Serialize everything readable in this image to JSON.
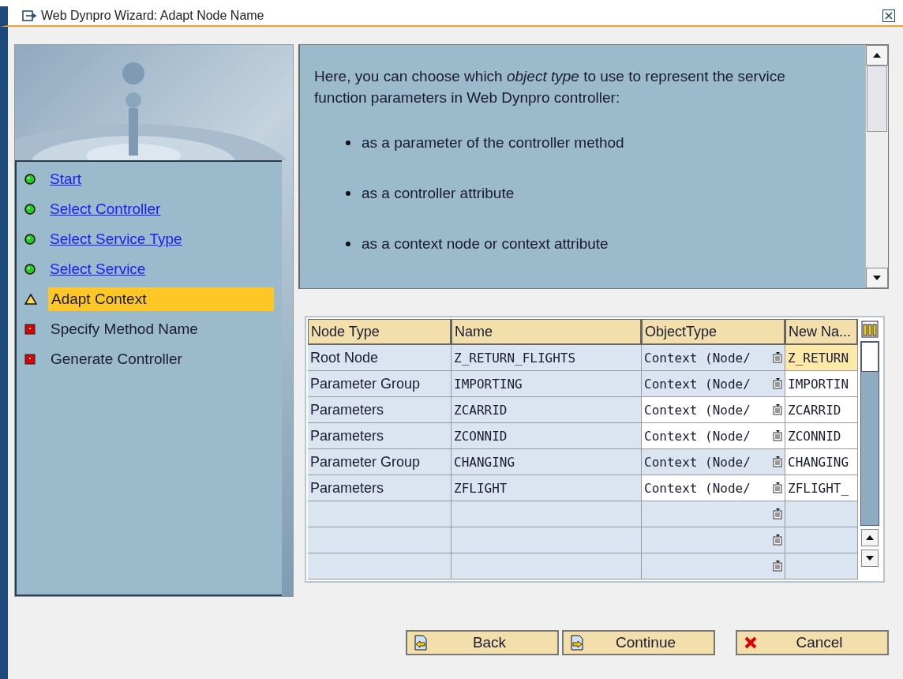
{
  "window": {
    "title": "Web Dynpro Wizard: Adapt Node Name"
  },
  "steps": [
    {
      "label": "Start",
      "kind": "done",
      "selected": false
    },
    {
      "label": "Select Controller",
      "kind": "done",
      "selected": false
    },
    {
      "label": "Select Service Type",
      "kind": "done",
      "selected": false
    },
    {
      "label": "Select Service",
      "kind": "done",
      "selected": false
    },
    {
      "label": "Adapt Context",
      "kind": "current",
      "selected": true
    },
    {
      "label": "Specify Method Name",
      "kind": "pending",
      "selected": false
    },
    {
      "label": "Generate Controller",
      "kind": "pending",
      "selected": false
    }
  ],
  "intro": "Here, you can choose which *object type* to use to represent the service function parameters in Web Dynpro controller:",
  "options": [
    "as a parameter of the controller method",
    "as a controller attribute",
    "as a context node or context attribute"
  ],
  "table": {
    "columns": [
      "Node Type",
      "Name",
      "ObjectType",
      "New Na..."
    ],
    "rows": [
      {
        "node_type": "Root Node",
        "name": "Z_RETURN_FLIGHTS",
        "object_type": "Context  (Node/",
        "new_name": "Z_RETURN",
        "editable": false,
        "selected": true
      },
      {
        "node_type": "Parameter Group",
        "name": "IMPORTING",
        "object_type": "Context  (Node/",
        "new_name": "IMPORTIN",
        "editable": false,
        "selected": false
      },
      {
        "node_type": "Parameters",
        "name": "ZCARRID",
        "object_type": "Context  (Node/",
        "new_name": "ZCARRID",
        "editable": true,
        "selected": false
      },
      {
        "node_type": "Parameters",
        "name": "ZCONNID",
        "object_type": "Context  (Node/",
        "new_name": "ZCONNID",
        "editable": true,
        "selected": false
      },
      {
        "node_type": "Parameter Group",
        "name": "CHANGING",
        "object_type": "Context  (Node/",
        "new_name": "CHANGING",
        "editable": false,
        "selected": false
      },
      {
        "node_type": "Parameters",
        "name": "ZFLIGHT",
        "object_type": "Context  (Node/",
        "new_name": "ZFLIGHT_",
        "editable": true,
        "selected": false
      }
    ]
  },
  "buttons": [
    {
      "label": "Back",
      "kind": "back"
    },
    {
      "label": "Continue",
      "kind": "continue"
    },
    {
      "label": "Cancel",
      "kind": "cancel"
    }
  ]
}
